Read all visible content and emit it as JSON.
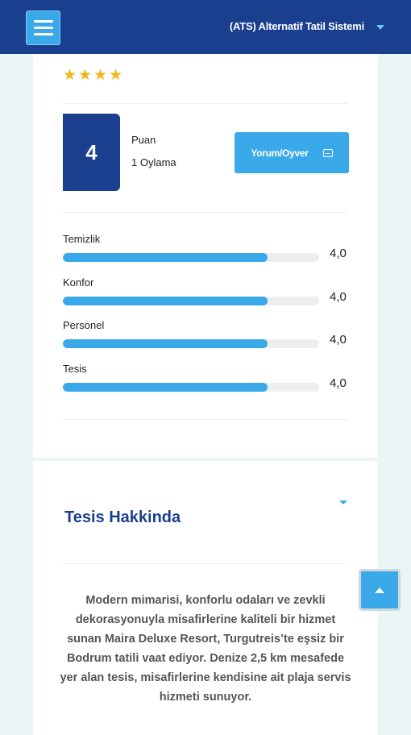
{
  "header": {
    "system_name": "(ATS) Alternatif Tatil Sistemi",
    "menu_icon": "hamburger-icon",
    "caret_icon": "caret-down-icon"
  },
  "rating_summary": {
    "stars": 4,
    "score": "4",
    "score_label": "Puan",
    "votes": "1 Oylama",
    "review_button": "Yorum/Oyver",
    "review_icon": "comment-icon"
  },
  "ratings": [
    {
      "label": "Temizlik",
      "value": "4,0",
      "fraction": 0.8
    },
    {
      "label": "Konfor",
      "value": "4,0",
      "fraction": 0.8
    },
    {
      "label": "Personel",
      "value": "4,0",
      "fraction": 0.8
    },
    {
      "label": "Tesis",
      "value": "4,0",
      "fraction": 0.8
    }
  ],
  "about": {
    "title": "Tesis Hakkinda",
    "text": "Modern mimarisi, konforlu odaları ve zevkli dekorasyonuyla misafirlerine kaliteli bir hizmet sunan Maira Deluxe Resort, Turgutreis’te eşsiz bir Bodrum tatili vaat ediyor. Denize 2,5 km mesafede yer alan tesis, misafirlerine kendisine ait plaja servis hizmeti sunuyor."
  },
  "scroll_top_icon": "arrow-up-icon",
  "colors": {
    "navy": "#1b3f8f",
    "accent": "#3aa9e9",
    "star": "#f5b41a"
  }
}
